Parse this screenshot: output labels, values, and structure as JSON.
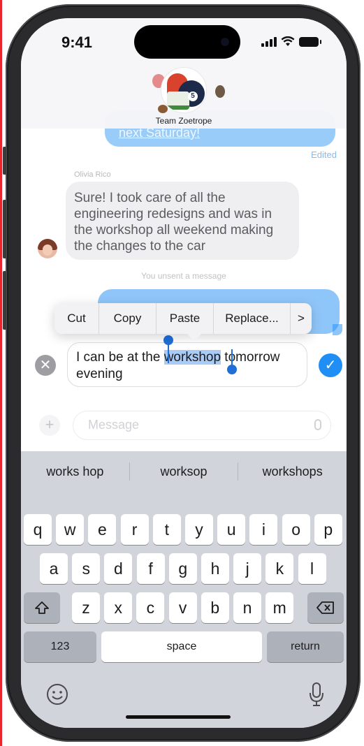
{
  "status_bar": {
    "time": "9:41"
  },
  "conversation": {
    "group_name": "Team Zoetrope",
    "top_bubble_text": "next Saturday!",
    "edited_label": "Edited",
    "sender_name": "Olivia Rico",
    "incoming_lines": [
      "Sure! I took care of all the",
      "engineering redesigns and was in",
      "the workshop all weekend making",
      "the changes to the car"
    ],
    "unsent_notice": "You unsent a message"
  },
  "context_menu": {
    "items": [
      "Cut",
      "Copy",
      "Paste",
      "Replace...",
      ">"
    ]
  },
  "edit_field": {
    "text_before": "I can be at the ",
    "selected_word": "workshop",
    "text_after": " tomorrow",
    "line2": "evening"
  },
  "compose": {
    "placeholder": "Message"
  },
  "keyboard": {
    "suggestions": [
      "works hop",
      "worksop",
      "workshops"
    ],
    "row1": [
      "q",
      "w",
      "e",
      "r",
      "t",
      "y",
      "u",
      "i",
      "o",
      "p"
    ],
    "row2": [
      "a",
      "s",
      "d",
      "f",
      "g",
      "h",
      "j",
      "k",
      "l"
    ],
    "row3": [
      "z",
      "x",
      "c",
      "v",
      "b",
      "n",
      "m"
    ],
    "numbers_key": "123",
    "space_key": "space",
    "return_key": "return"
  },
  "colors": {
    "accent_blue": "#1f8ef5",
    "keyboard_bg": "#d1d4db"
  },
  "icons": [
    "shift-icon",
    "backspace-icon",
    "emoji-icon",
    "microphone-icon",
    "cancel-icon",
    "checkmark-icon",
    "plus-icon",
    "chevron-right-icon"
  ]
}
